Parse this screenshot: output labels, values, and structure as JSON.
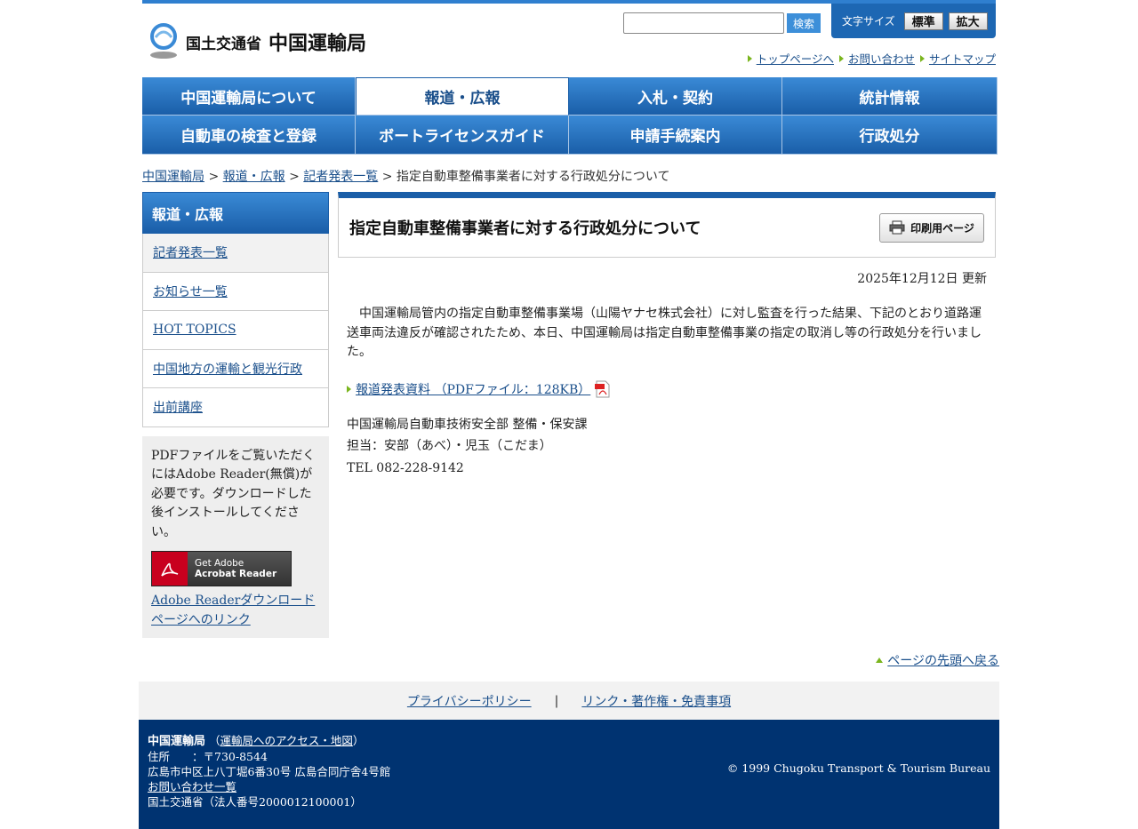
{
  "header": {
    "logo_small": "国土交通省",
    "logo_big": "中国運輸局",
    "search_button": "検索",
    "fontsize_label": "文字サイズ",
    "fontsize_standard": "標準",
    "fontsize_large": "拡大",
    "util_links": [
      "トップページへ",
      "お問い合わせ",
      "サイトマップ"
    ]
  },
  "nav": [
    "中国運輸局について",
    "報道・広報",
    "入札・契約",
    "統計情報",
    "自動車の検査と登録",
    "ボートライセンスガイド",
    "申請手続案内",
    "行政処分"
  ],
  "breadcrumb": {
    "items": [
      "中国運輸局",
      "報道・広報",
      "記者発表一覧"
    ],
    "separator": " > ",
    "current": "指定自動車整備事業者に対する行政処分について"
  },
  "sidebar": {
    "title": "報道・広報",
    "items": [
      "記者発表一覧",
      "お知らせ一覧",
      "HOT TOPICS",
      "中国地方の運輸と観光行政",
      "出前講座"
    ],
    "pdf_note": "PDFファイルをご覧いただくにはAdobe Reader(無償)が必要です。ダウンロードした後インストールしてください。",
    "adobe_badge_line1": "Get Adobe",
    "adobe_badge_line2": "Acrobat Reader",
    "adobe_link": "Adobe Readerダウンロードページへのリンク"
  },
  "main": {
    "title": "指定自動車整備事業者に対する行政処分について",
    "print_button": "印刷用ページ",
    "updated": "2025年12月12日 更新",
    "body": "中国運輸局管内の指定自動車整備事業場（山陽ヤナセ株式会社）に対し監査を行った結果、下記のとおり道路運送車両法違反が確認されたため、本日、中国運輸局は指定自動車整備事業の指定の取消し等の行政処分を行いました。",
    "pdf_link": "報道発表資料 （PDFファイル：128KB）",
    "contact_dept": "中国運輸局自動車技術安全部 整備・保安課",
    "contact_person": "担当：安部（あべ）・児玉（こだま）",
    "contact_tel": "TEL 082-228-9142"
  },
  "back_to_top": "ページの先頭へ戻る",
  "footer": {
    "privacy": "プライバシーポリシー",
    "separator": "|",
    "links": "リンク・著作権・免責事項",
    "org": "中国運輸局",
    "access_link": "運輸局へのアクセス・地図",
    "address_label": "住所　　：",
    "postal": "〒730-8544",
    "address": "広島市中区上八丁堀6番30号 広島合同庁舎4号館",
    "contact_list": "お問い合わせ一覧",
    "corp_number": "国土交通省（法人番号2000012100001）",
    "copyright": "© 1999 Chugoku Transport & Tourism Bureau"
  }
}
